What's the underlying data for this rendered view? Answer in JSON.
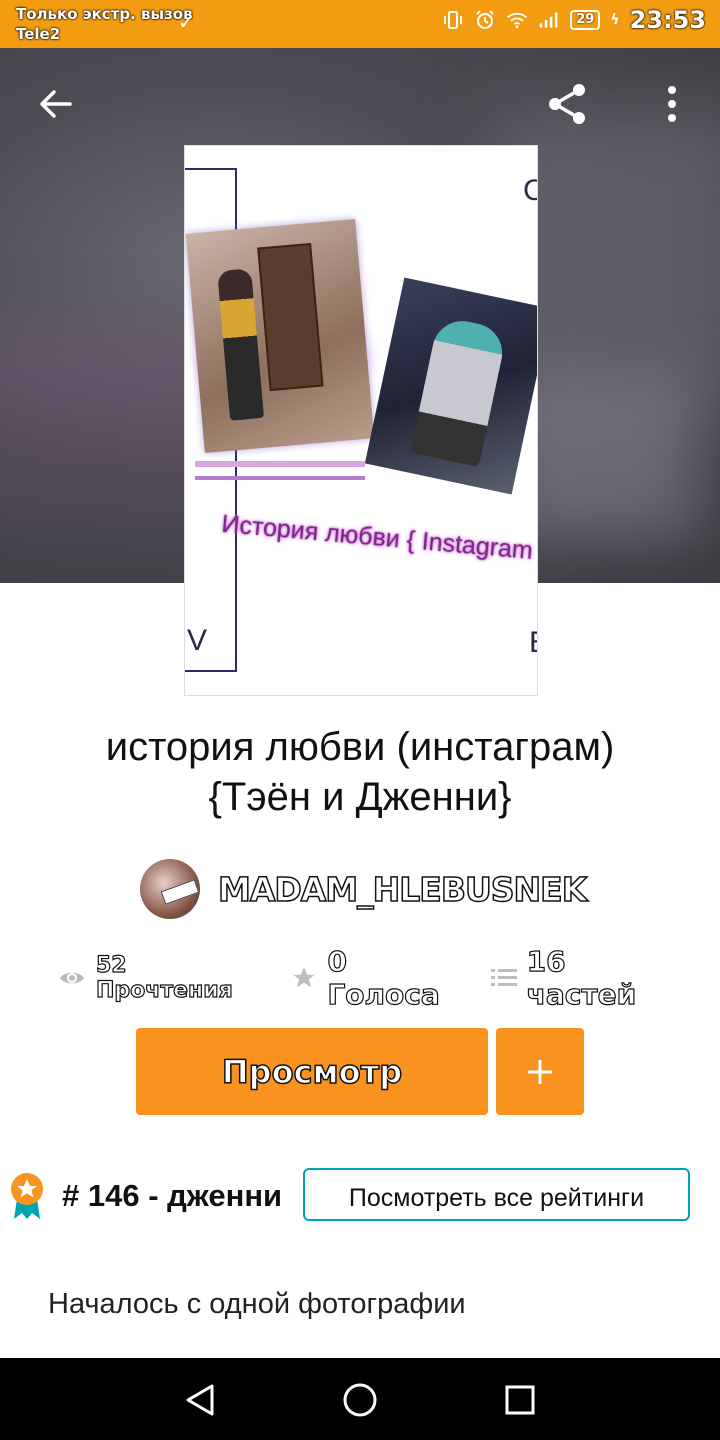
{
  "status_bar": {
    "carrier_line1": "Только экстр. вызов",
    "carrier_line2": "Tele2",
    "battery_level": "29",
    "time": "23:53",
    "icons": [
      "check-icon",
      "vibrate-icon",
      "alarm-icon",
      "wifi-icon",
      "signal-icon",
      "battery-icon",
      "charging-icon"
    ]
  },
  "toolbar": {
    "icons": [
      "back-arrow-icon",
      "share-icon",
      "more-vertical-icon"
    ]
  },
  "cover": {
    "title_text": "История любви { Instagram }",
    "left_letter": "V",
    "right_top_letter": "C",
    "right_bottom_letter": "E"
  },
  "story": {
    "title_line1": "история любви (инстаграм)",
    "title_line2": "{Тэён и Дженни}",
    "author": "MADAM_HLEBUSNEK"
  },
  "stats": {
    "reads": "52 Прочтения",
    "votes": "0 Голоса",
    "parts": "16 частей",
    "icons": [
      "eye-icon",
      "star-icon",
      "list-icon"
    ]
  },
  "actions": {
    "read_label": "Просмотр",
    "add_label": "+"
  },
  "ranking": {
    "text": "# 146 - дженни",
    "view_all_label": "Посмотреть все рейтинги",
    "icon": "rank-badge-icon"
  },
  "description": "Началось с одной фотографии",
  "nav_bar": {
    "icons": [
      "back-triangle-icon",
      "home-circle-icon",
      "recents-square-icon"
    ]
  },
  "colors": {
    "status_bar": "#f39c12",
    "accent_orange": "#f7931e",
    "ratings_border": "#00a3b4",
    "nav_bar": "#000000"
  }
}
